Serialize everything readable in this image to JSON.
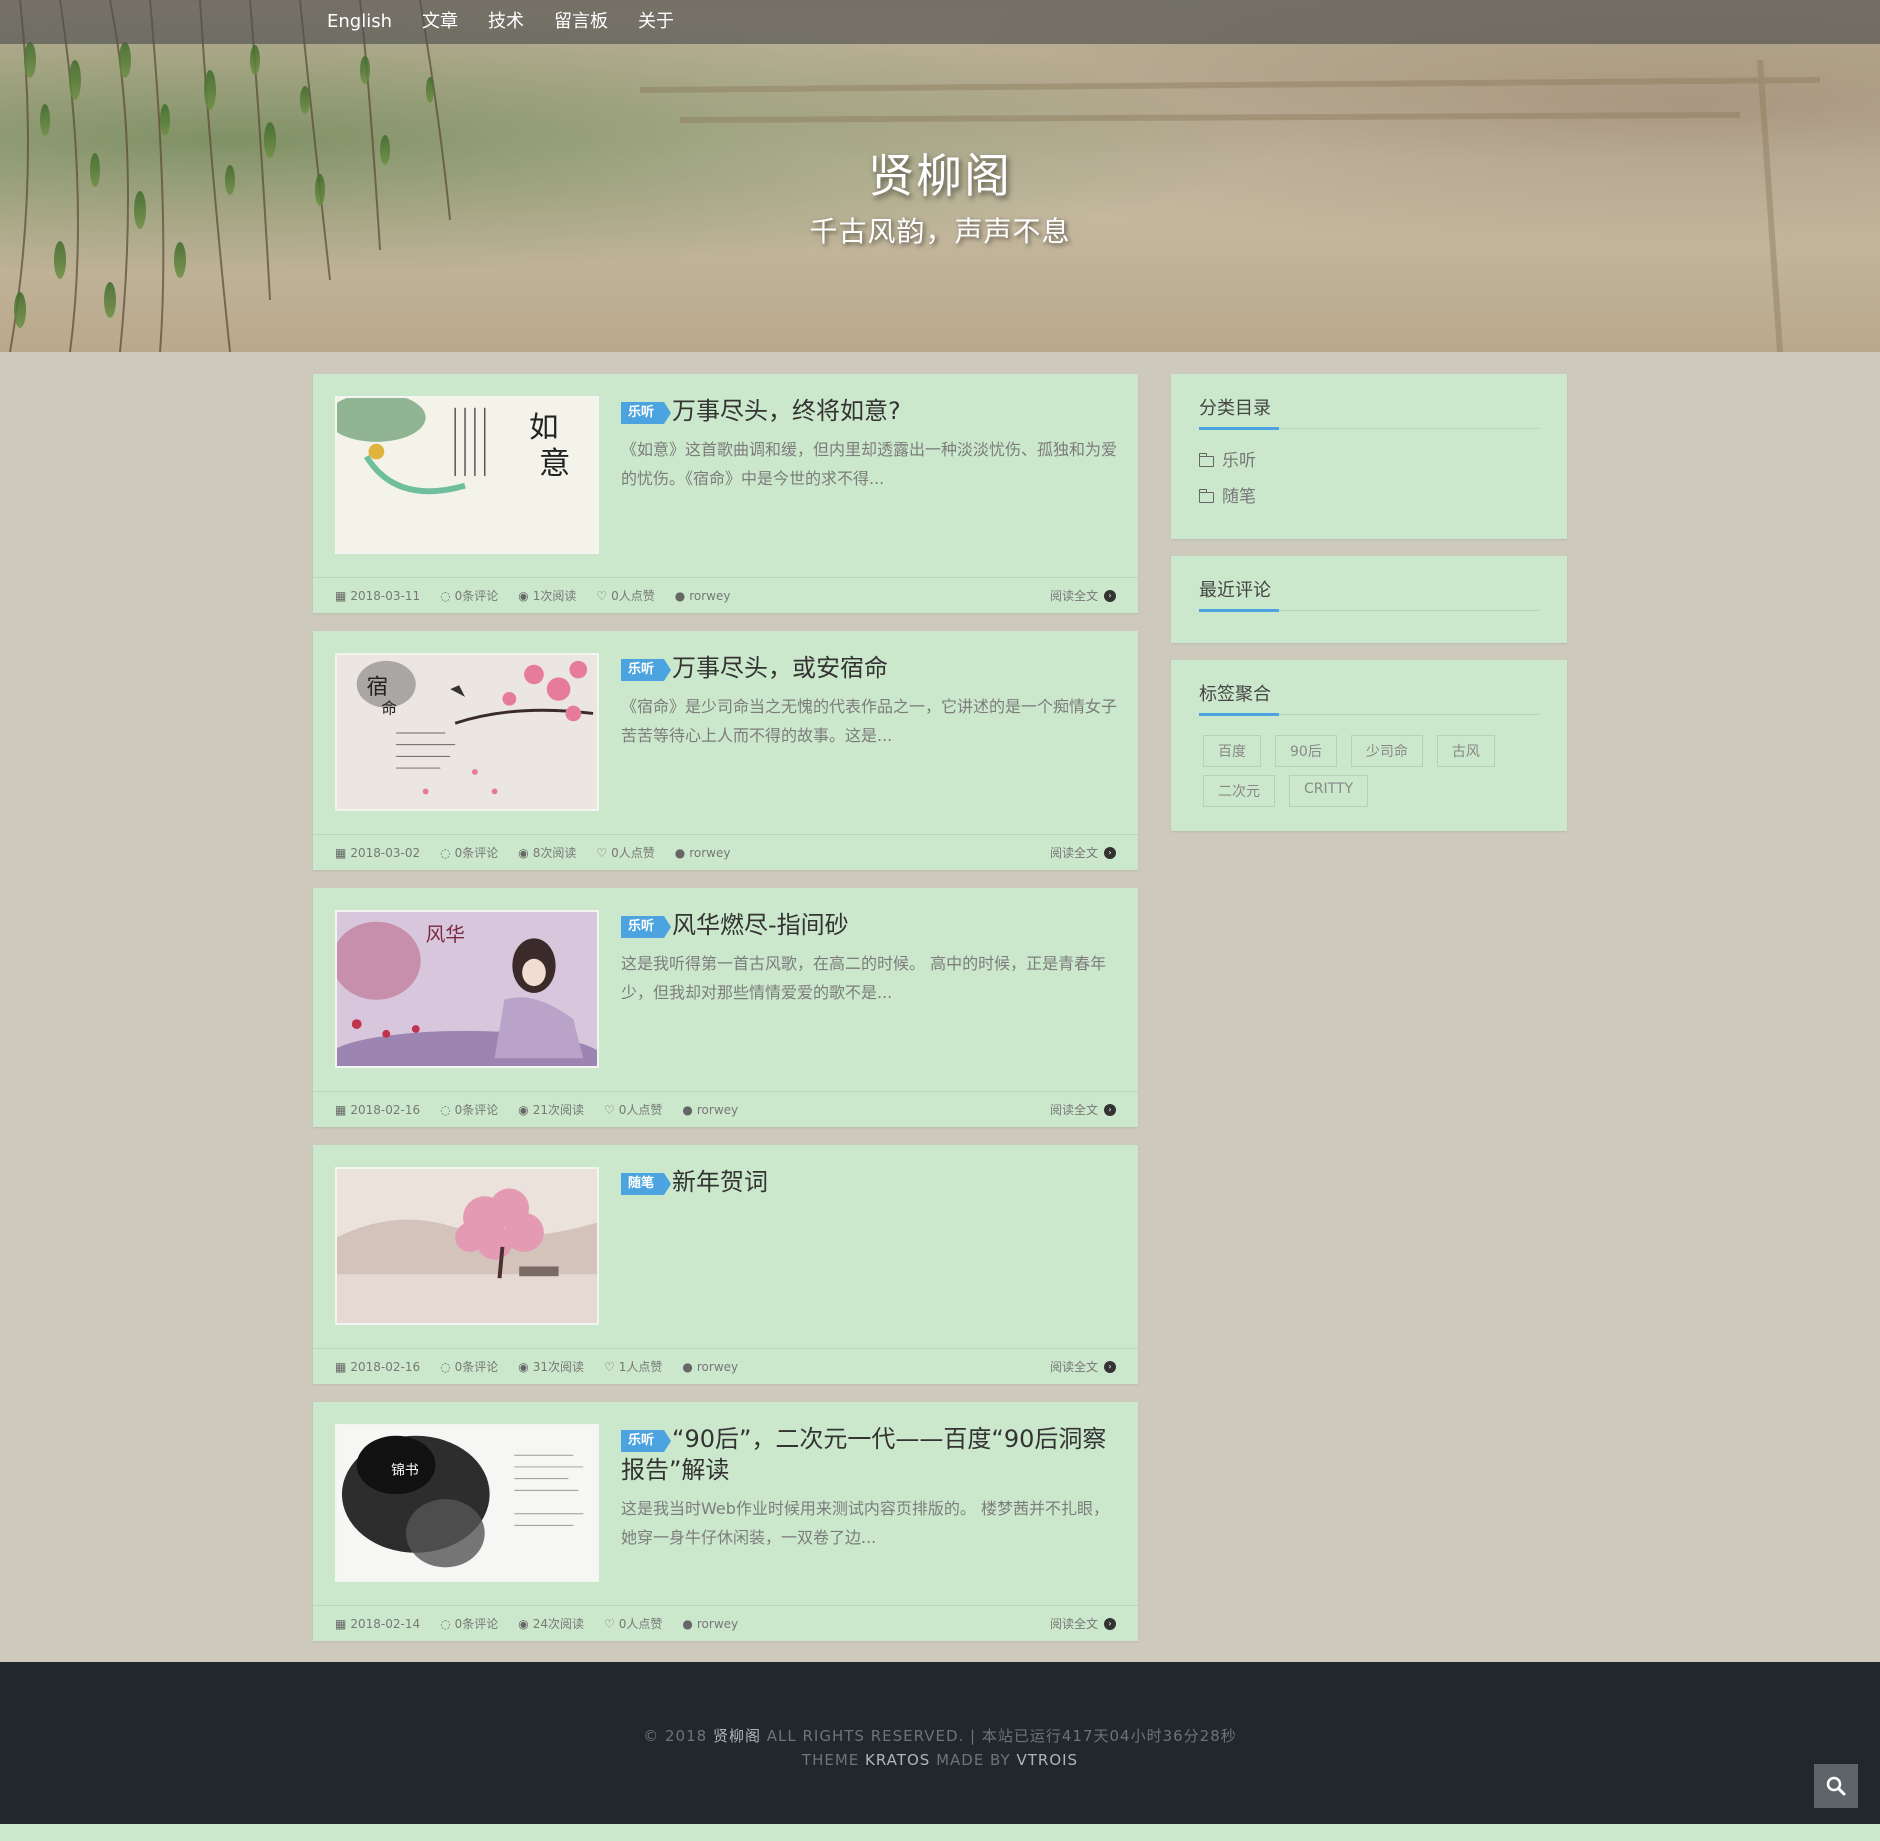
{
  "nav": {
    "items": [
      "English",
      "文章",
      "技术",
      "留言板",
      "关于"
    ]
  },
  "hero": {
    "title": "贤柳阁",
    "subtitle": "千古风韵，声声不息"
  },
  "posts": [
    {
      "category": "乐听",
      "title": "万事尽头，终将如意?",
      "excerpt": "《如意》这首歌曲调和缓，但内里却透露出一种淡淡忧伤、孤独和为爱的忧伤。《宿命》中是今世的求不得...",
      "date": "2018-03-11",
      "comments": "0条评论",
      "views": "1次阅读",
      "likes": "0人点赞",
      "author": "rorwey",
      "read_more": "阅读全文"
    },
    {
      "category": "乐听",
      "title": "万事尽头，或安宿命",
      "excerpt": "《宿命》是少司命当之无愧的代表作品之一，它讲述的是一个痴情女子苦苦等待心上人而不得的故事。这是...",
      "date": "2018-03-02",
      "comments": "0条评论",
      "views": "8次阅读",
      "likes": "0人点赞",
      "author": "rorwey",
      "read_more": "阅读全文"
    },
    {
      "category": "乐听",
      "title": "风华燃尽-指间砂",
      "excerpt": "这是我听得第一首古风歌，在高二的时候。 高中的时候，正是青春年少，但我却对那些情情爱爱的歌不是...",
      "date": "2018-02-16",
      "comments": "0条评论",
      "views": "21次阅读",
      "likes": "0人点赞",
      "author": "rorwey",
      "read_more": "阅读全文"
    },
    {
      "category": "随笔",
      "title": "新年贺词",
      "excerpt": "",
      "date": "2018-02-16",
      "comments": "0条评论",
      "views": "31次阅读",
      "likes": "1人点赞",
      "author": "rorwey",
      "read_more": "阅读全文"
    },
    {
      "category": "乐听",
      "title": "“90后”，二次元一代——百度“90后洞察报告”解读",
      "excerpt": "这是我当时Web作业时候用来测试内容页排版的。 楼梦茜并不扎眼，她穿一身牛仔休闲装，一双卷了边...",
      "date": "2018-02-14",
      "comments": "0条评论",
      "views": "24次阅读",
      "likes": "0人点赞",
      "author": "rorwey",
      "read_more": "阅读全文"
    }
  ],
  "sidebar": {
    "categories_title": "分类目录",
    "categories": [
      "乐听",
      "随笔"
    ],
    "recent_comments_title": "最近评论",
    "tags_title": "标签聚合",
    "tags": [
      "百度",
      "90后",
      "少司命",
      "古风",
      "二次元",
      "CRITTY"
    ]
  },
  "footer": {
    "copyright_prefix": "© 2018",
    "site_name": "贤柳阁",
    "rights": "ALL RIGHTS RESERVED. | 本站已运行417天04小时36分28秒",
    "theme_prefix": "THEME",
    "theme_name": "KRATOS",
    "made_by": "MADE BY",
    "author": "VTROIS"
  },
  "colors": {
    "accent": "#4ba3e0",
    "card_bg": "#cce8cc",
    "page_bg": "#cdc9bd",
    "footer_bg": "#22272b"
  },
  "icons": {
    "date": "calendar-icon",
    "comments": "comment-icon",
    "views": "eye-icon",
    "likes": "thumbs-up-icon",
    "author": "user-icon",
    "read_more": "arrow-circle-right-icon",
    "search": "search-icon",
    "category": "folder-icon"
  }
}
